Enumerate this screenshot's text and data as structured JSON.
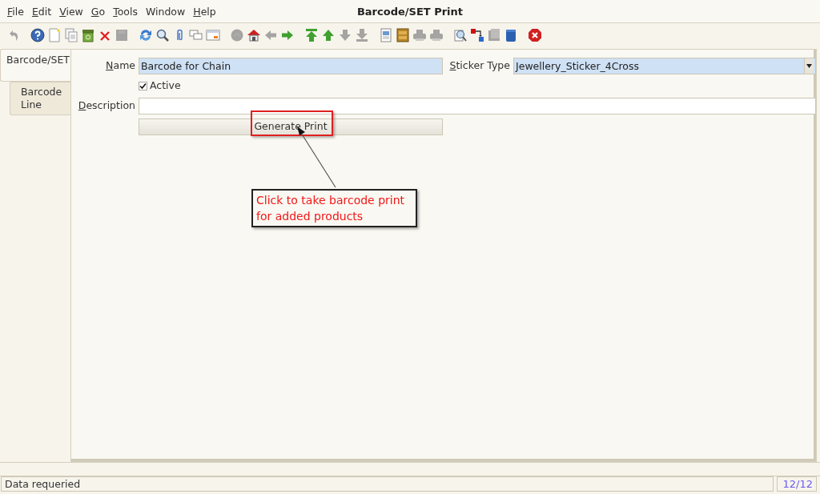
{
  "menu": [
    {
      "label": "File",
      "mnemonic": true
    },
    {
      "label": "Edit",
      "mnemonic": true
    },
    {
      "label": "View",
      "mnemonic": true
    },
    {
      "label": "Go",
      "mnemonic": true
    },
    {
      "label": "Tools",
      "mnemonic": true
    },
    {
      "label": "Window",
      "mnemonic": false
    },
    {
      "label": "Help",
      "mnemonic": true
    }
  ],
  "window": {
    "title": "Barcode/SET Print"
  },
  "toolbar": [
    {
      "kind": "undo",
      "disabled": true
    },
    {
      "kind": "gap"
    },
    {
      "kind": "help",
      "disabled": false
    },
    {
      "kind": "new",
      "disabled": false
    },
    {
      "kind": "copy",
      "disabled": false
    },
    {
      "kind": "bin",
      "disabled": false
    },
    {
      "kind": "delete",
      "disabled": false
    },
    {
      "kind": "save",
      "disabled": true
    },
    {
      "kind": "gap"
    },
    {
      "kind": "refresh",
      "disabled": false
    },
    {
      "kind": "find",
      "disabled": false
    },
    {
      "kind": "attach",
      "disabled": false
    },
    {
      "kind": "chat",
      "disabled": false
    },
    {
      "kind": "grid",
      "disabled": false
    },
    {
      "kind": "gap"
    },
    {
      "kind": "history",
      "disabled": true
    },
    {
      "kind": "home",
      "disabled": false
    },
    {
      "kind": "back",
      "disabled": true
    },
    {
      "kind": "forward",
      "disabled": false
    },
    {
      "kind": "gap"
    },
    {
      "kind": "first",
      "disabled": false
    },
    {
      "kind": "up",
      "disabled": false
    },
    {
      "kind": "down",
      "disabled": true
    },
    {
      "kind": "last",
      "disabled": true
    },
    {
      "kind": "gap"
    },
    {
      "kind": "report",
      "disabled": false
    },
    {
      "kind": "archive",
      "disabled": false
    },
    {
      "kind": "print",
      "disabled": true
    },
    {
      "kind": "print",
      "disabled": true
    },
    {
      "kind": "gap"
    },
    {
      "kind": "zoom",
      "disabled": false
    },
    {
      "kind": "transfer",
      "disabled": false
    },
    {
      "kind": "product",
      "disabled": true
    },
    {
      "kind": "box",
      "disabled": false
    },
    {
      "kind": "gap"
    },
    {
      "kind": "close",
      "disabled": false
    }
  ],
  "tabs": [
    {
      "label": "Barcode/SET",
      "selected": true
    },
    {
      "label": "Barcode Line",
      "selected": false
    }
  ],
  "form": {
    "name": {
      "label": "Name",
      "mnemonic": true,
      "value": "Barcode for Chain"
    },
    "sticker_type": {
      "label": "Sticker Type",
      "mnemonic": true,
      "value": "Jewellery_Sticker_4Cross"
    },
    "active": {
      "label": "Active",
      "checked": true
    },
    "description": {
      "label": "Description",
      "mnemonic": true
    },
    "button": {
      "label": "Generate Print"
    }
  },
  "annotation": {
    "text": "Click to take barcode print\nfor added products"
  },
  "status_bar": {
    "message": "Data requeried",
    "record": "12/12"
  }
}
